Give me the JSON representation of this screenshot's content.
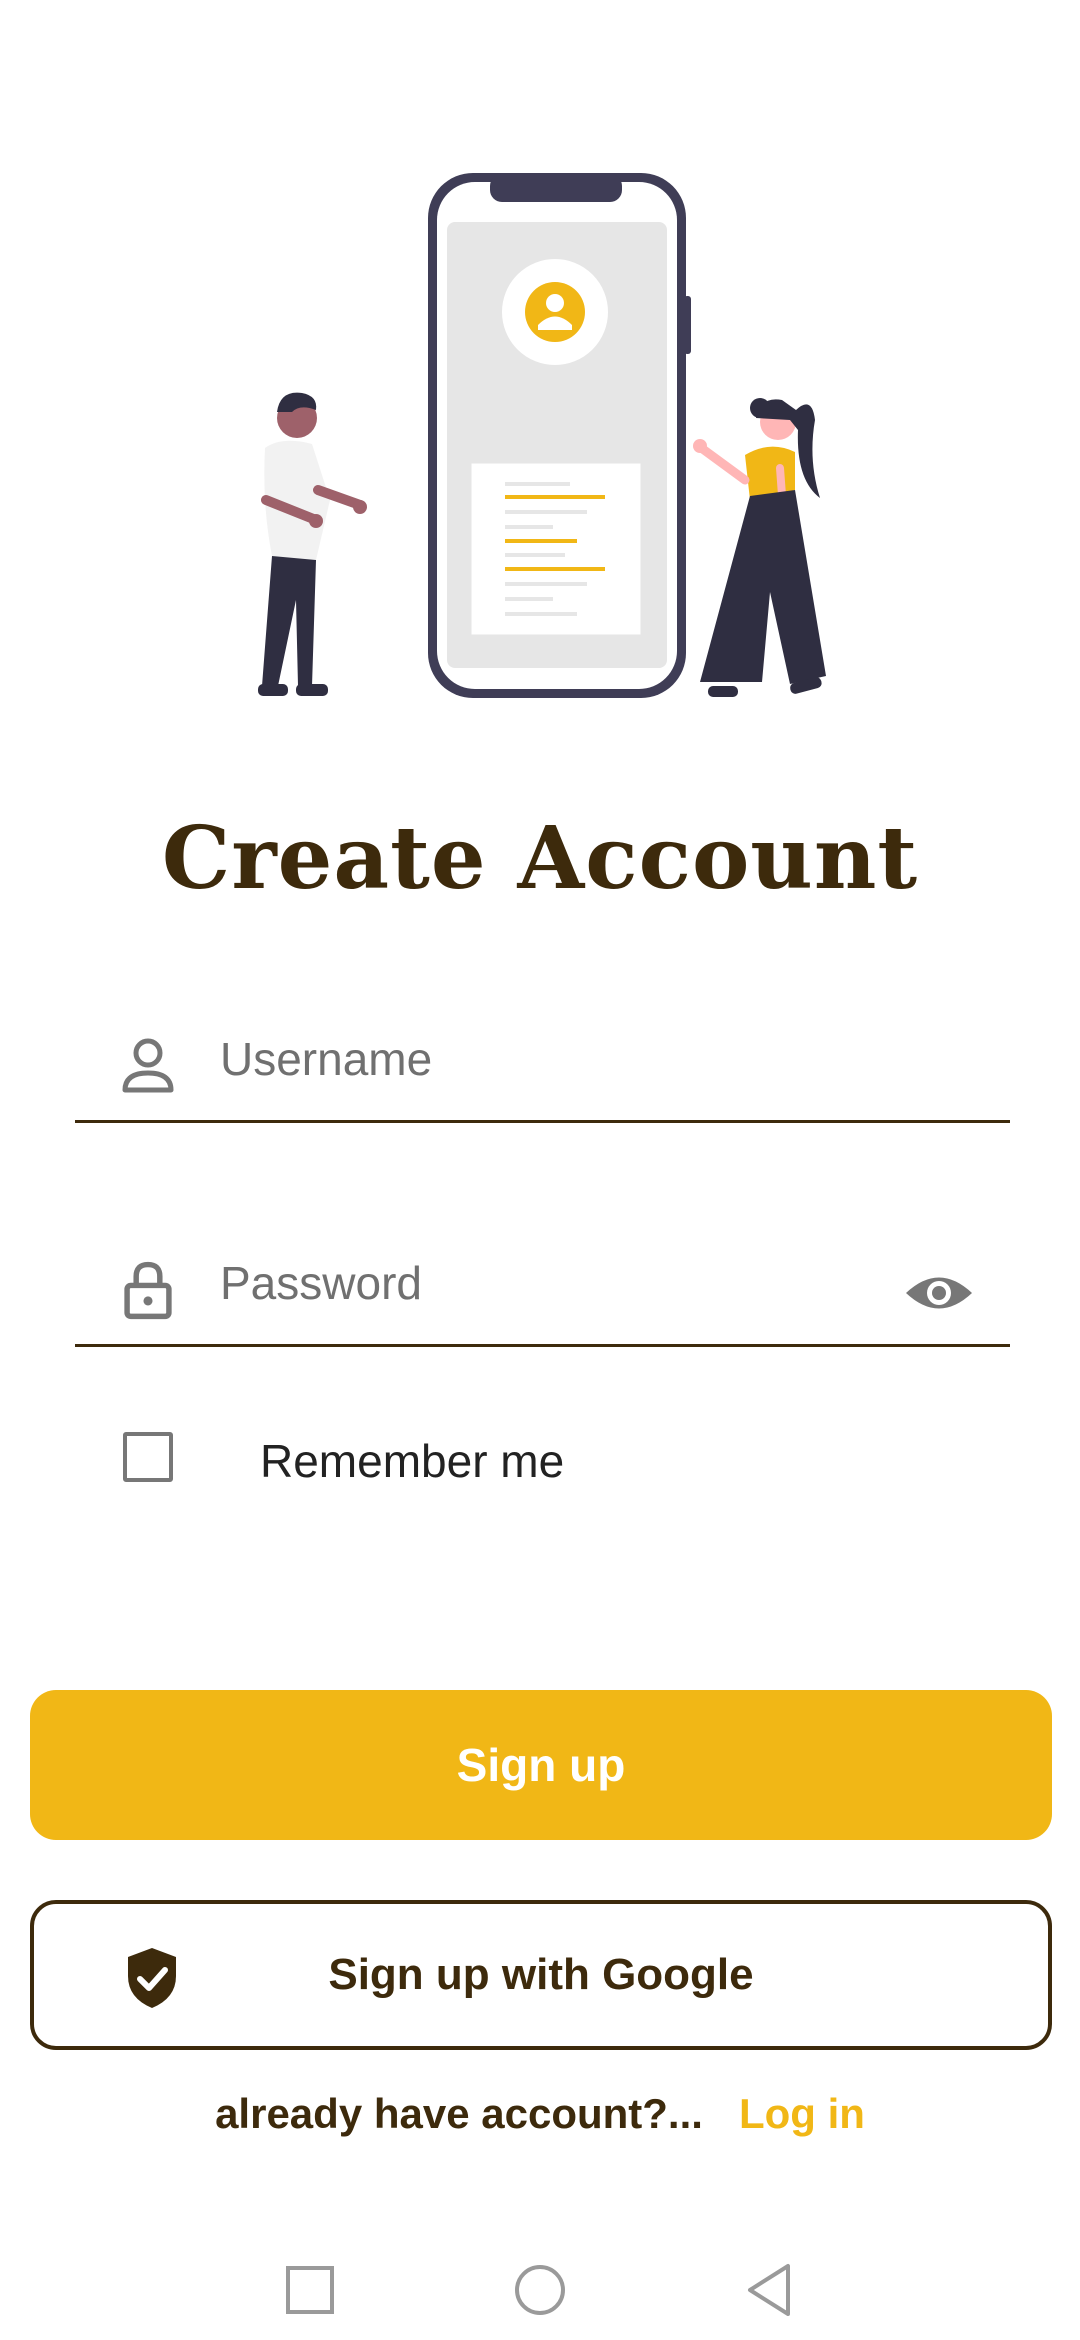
{
  "screen": {
    "title": "Create Account"
  },
  "form": {
    "username_placeholder": "Username",
    "password_placeholder": "Password",
    "remember_label": "Remember me",
    "remember_checked": false
  },
  "buttons": {
    "signup_label": "Sign up",
    "google_label": "Sign up with Google"
  },
  "footer": {
    "question": "already have account?...",
    "login_link": "Log in"
  },
  "icons": {
    "username": "person-icon",
    "password": "lock-icon",
    "visibility": "eye-icon",
    "google": "shield-check-icon",
    "nav": [
      "square-icon",
      "circle-icon",
      "triangle-back-icon"
    ]
  },
  "colors": {
    "accent": "#f1b716",
    "brand_dark": "#3d2a0c",
    "placeholder": "#707070"
  }
}
